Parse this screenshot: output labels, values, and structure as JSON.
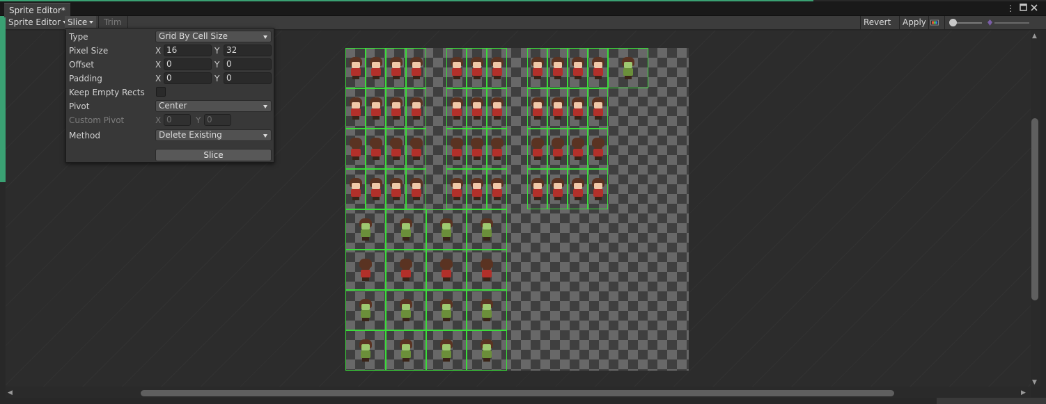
{
  "window": {
    "tab_title": "Sprite Editor*"
  },
  "toolbar": {
    "mode_label": "Sprite Editor",
    "slice_label": "Slice",
    "trim_label": "Trim",
    "revert_label": "Revert",
    "apply_label": "Apply"
  },
  "slice_panel": {
    "type_label": "Type",
    "type_value": "Grid By Cell Size",
    "pixel_size_label": "Pixel Size",
    "pixel_size_x": "16",
    "pixel_size_y": "32",
    "offset_label": "Offset",
    "offset_x": "0",
    "offset_y": "0",
    "padding_label": "Padding",
    "padding_x": "0",
    "padding_y": "0",
    "keep_empty_label": "Keep Empty Rects",
    "keep_empty_checked": false,
    "pivot_label": "Pivot",
    "pivot_value": "Center",
    "custom_pivot_label": "Custom Pivot",
    "custom_pivot_x": "0",
    "custom_pivot_y": "0",
    "method_label": "Method",
    "method_value": "Delete Existing",
    "slice_button": "Slice",
    "axis_x": "X",
    "axis_y": "Y"
  },
  "icons": {
    "menu": "kebab-menu-icon",
    "maximize": "maximize-icon",
    "close": "close-icon",
    "channel": "color-channel-icon",
    "zoom": "zoom-slider-icon"
  },
  "colors": {
    "slice_outline": "#3adc3a",
    "accent_green": "#3aa173"
  }
}
